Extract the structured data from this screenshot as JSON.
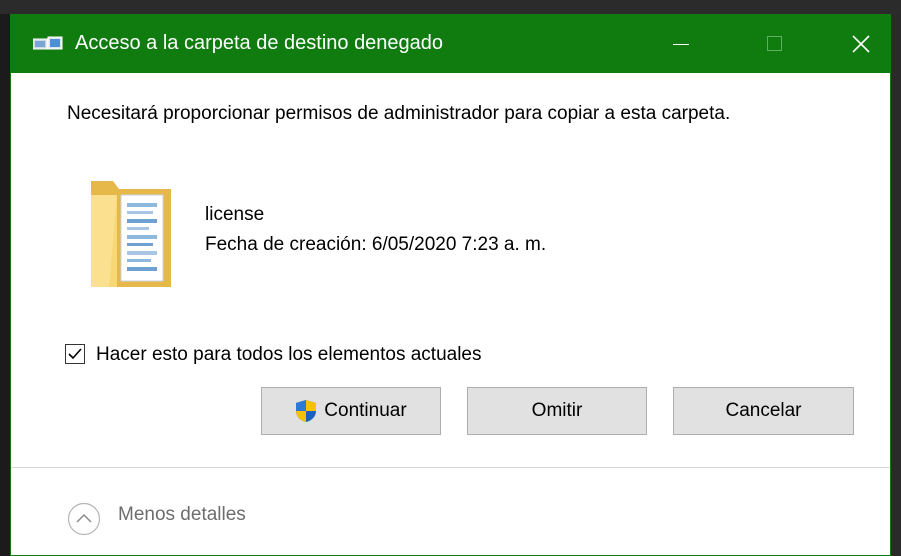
{
  "dialog": {
    "title": "Acceso a la carpeta de destino denegado",
    "message": "Necesitará proporcionar permisos de administrador para copiar a esta carpeta.",
    "accent_color": "#107c10"
  },
  "item": {
    "name": "license",
    "created": "Fecha de creación: 6/05/2020 7:23 a. m.",
    "icon": "folder-icon"
  },
  "checkbox": {
    "label": "Hacer esto para todos los elementos actuales",
    "checked": true
  },
  "buttons": {
    "continue": "Continuar",
    "skip": "Omitir",
    "cancel": "Cancelar"
  },
  "details": {
    "label": "Menos detalles"
  }
}
